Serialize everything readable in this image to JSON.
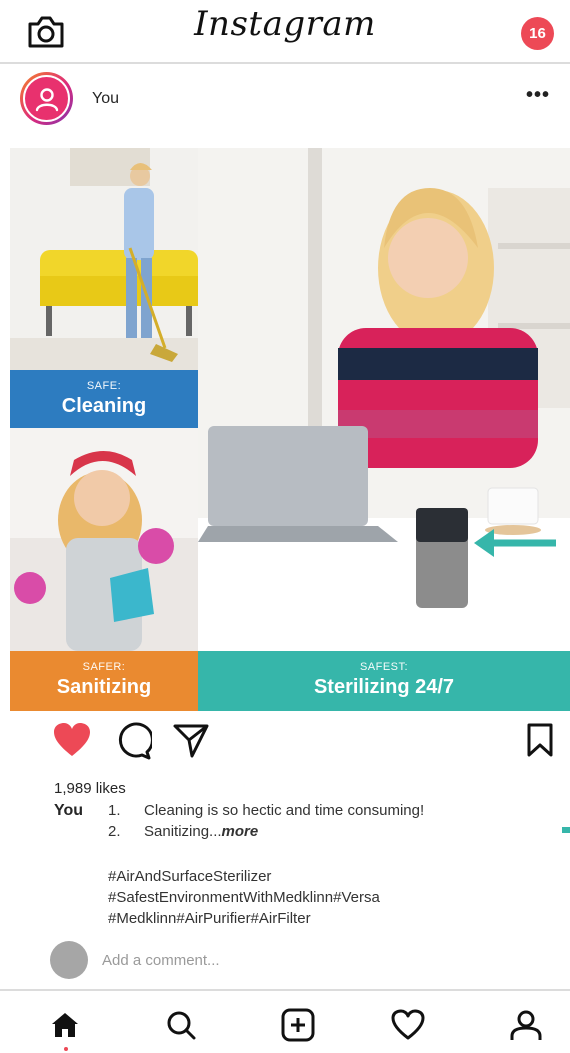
{
  "app": {
    "logo": "Instagram",
    "notification_count": "16",
    "icons": [
      "camera-icon"
    ]
  },
  "post": {
    "username": "You",
    "more_label": "•••",
    "image": {
      "panels": [
        {
          "small": "SAFE:",
          "big": "Cleaning",
          "color": "#2d7cc0"
        },
        {
          "small": "SAFER:",
          "big": "Sanitizing",
          "color": "#ea8a30"
        },
        {
          "small": "SAFEST:",
          "big": "Sterilizing 24/7",
          "color": "#36b6aa"
        }
      ]
    },
    "likes": "1,989 likes",
    "caption": {
      "user": "You",
      "items": [
        {
          "num": "1.",
          "text": "Cleaning is so hectic and time consuming!"
        },
        {
          "num": "2.",
          "text": "Sanitizing...",
          "more": "more"
        }
      ],
      "hashtags": [
        "#AirAndSurfaceSterilizer",
        "#SafestEnvironmentWithMedklinn#Versa",
        "#Medklinn#AirPurifier#AirFilter"
      ]
    },
    "comment": {
      "placeholder": "Add a comment..."
    }
  },
  "colors": {
    "like_red": "#ed4956",
    "teal": "#36b6aa",
    "blue": "#2d7cc0",
    "orange": "#ea8a30"
  },
  "bottom_nav": [
    "home-icon",
    "search-icon",
    "add-post-icon",
    "activity-heart-icon",
    "profile-icon"
  ]
}
